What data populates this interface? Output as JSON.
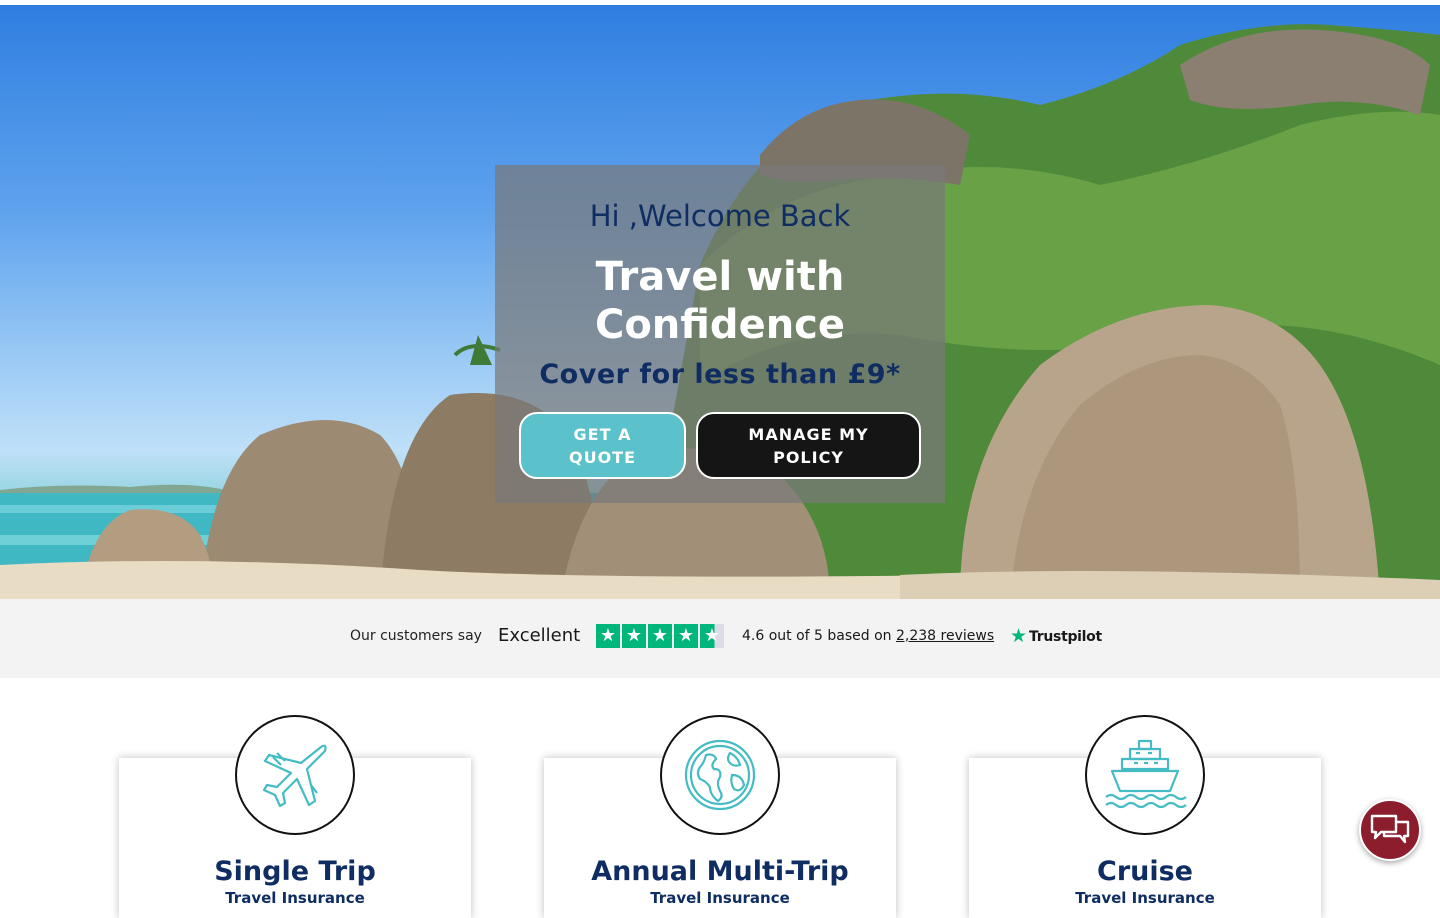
{
  "hero": {
    "welcome": "Hi ,Welcome Back",
    "headline": "Travel with Confidence",
    "subline": "Cover for less than £9*",
    "get_quote_label": "GET A QUOTE",
    "manage_policy_label": "MANAGE MY POLICY"
  },
  "trustbar": {
    "customers_say": "Our customers say",
    "rating_word": "Excellent",
    "rating": 4.6,
    "score_text": "4.6 out of 5 based on",
    "reviews_link": "2,238 reviews",
    "brand": "Trustpilot"
  },
  "products": [
    {
      "title": "Single Trip",
      "subtitle": "Travel Insurance",
      "icon": "airplane-icon"
    },
    {
      "title": "Annual Multi-Trip",
      "subtitle": "Travel Insurance",
      "icon": "globe-icon"
    },
    {
      "title": "Cruise",
      "subtitle": "Travel Insurance",
      "icon": "cruise-ship-icon"
    }
  ],
  "colors": {
    "navy": "#0f2d63",
    "teal": "#5bc2cb",
    "trustpilot_green": "#00b67a",
    "chat_maroon": "#8b1d2c"
  },
  "chat": {
    "icon": "chat-bubbles-icon"
  }
}
